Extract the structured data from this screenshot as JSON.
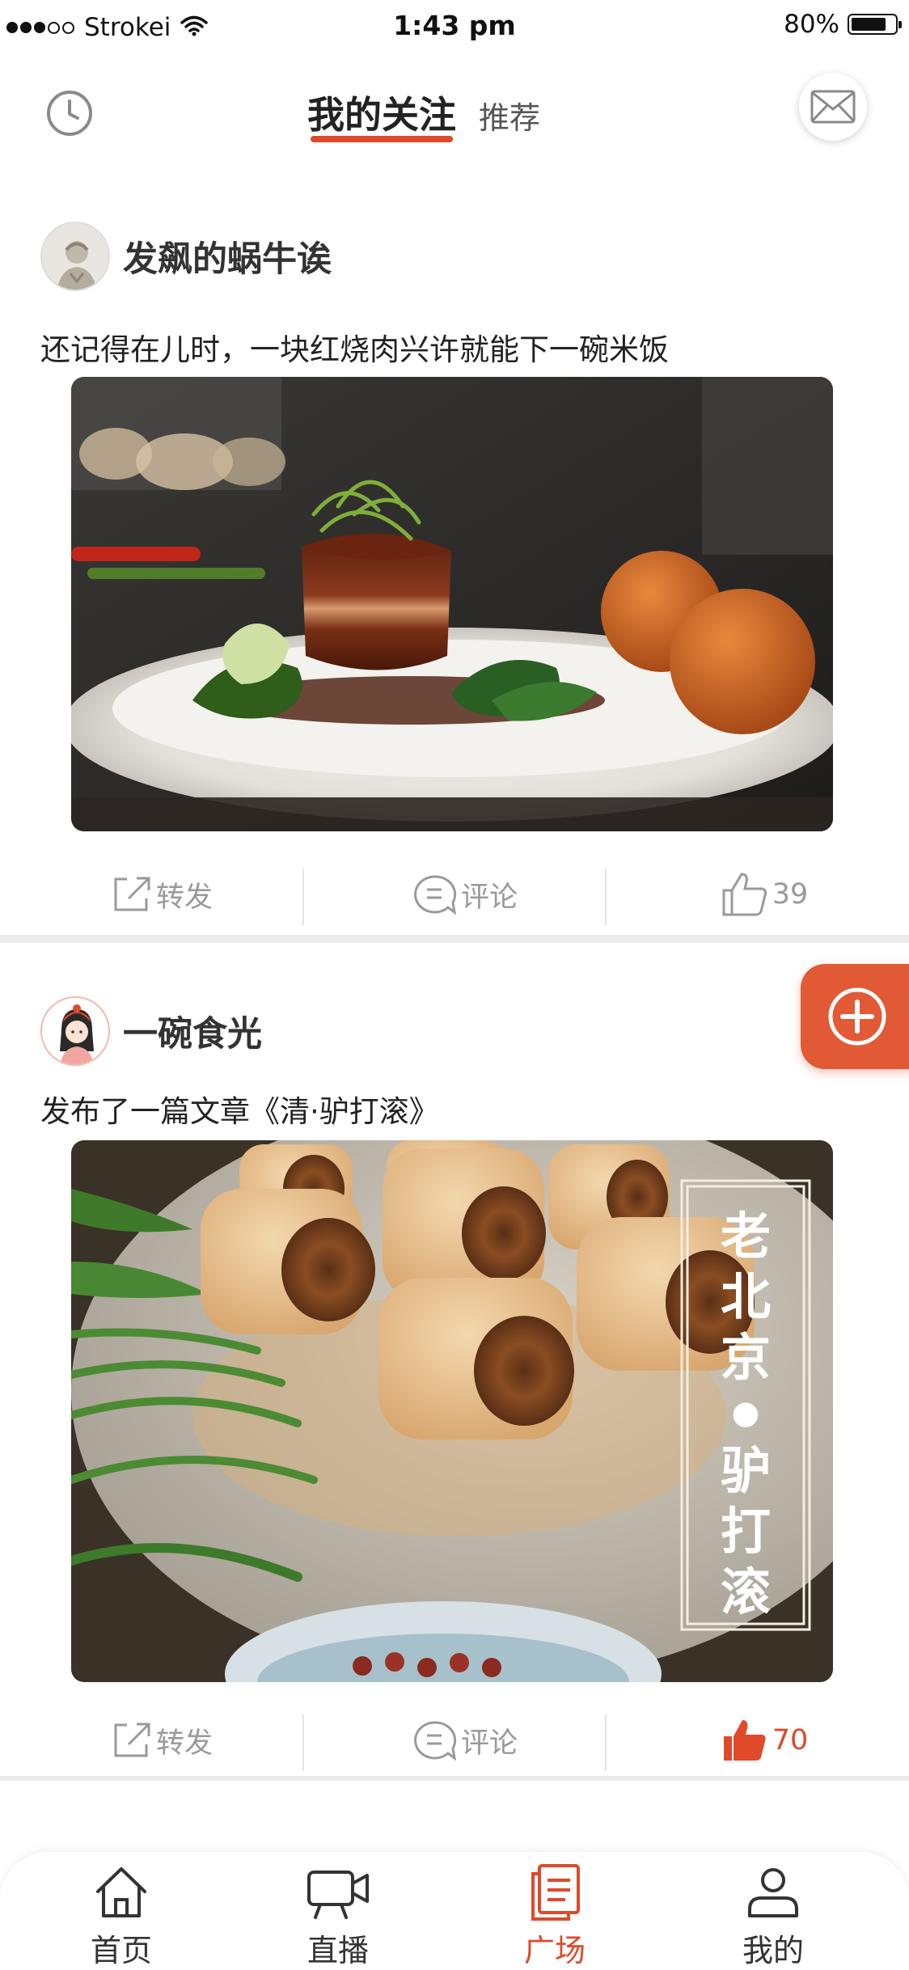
{
  "status_bar": {
    "carrier": "Strokei",
    "time": "1:43 pm",
    "battery_percent": "80%",
    "battery_level": 0.8
  },
  "header": {
    "tabs": [
      {
        "label": "我的关注",
        "active": true
      },
      {
        "label": "推荐",
        "active": false
      }
    ],
    "history_icon": "clock-icon",
    "mail_icon": "envelope-icon"
  },
  "posts": [
    {
      "author": "发飙的蜗牛诶",
      "text": "还记得在儿时，一块红烧肉兴许就能下一碗米饭",
      "image": "braised-pork-photo",
      "actions": {
        "share": "转发",
        "comment": "评论",
        "likes": "39",
        "liked": false
      }
    },
    {
      "author": "一碗食光",
      "text": "发布了一篇文章《清·驴打滚》",
      "image": "lvdagun-photo",
      "image_caption": "老北京●驴打滚",
      "actions": {
        "share": "转发",
        "comment": "评论",
        "likes": "70",
        "liked": true
      }
    }
  ],
  "fab_icon": "plus-circle-icon",
  "bottom_nav": [
    {
      "label": "首页",
      "icon": "home-icon",
      "active": false
    },
    {
      "label": "直播",
      "icon": "video-camera-icon",
      "active": false
    },
    {
      "label": "广场",
      "icon": "document-icon",
      "active": true
    },
    {
      "label": "我的",
      "icon": "user-icon",
      "active": false
    }
  ],
  "colors": {
    "accent": "#e0492a",
    "muted": "#9a9a9a",
    "separator": "#ebebeb"
  }
}
